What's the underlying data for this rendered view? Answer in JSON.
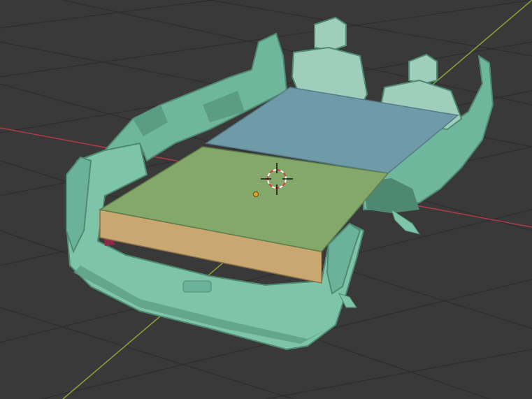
{
  "app": "3D viewport",
  "viewport": {
    "background": "#393939",
    "grid_color": "#2b2b2b",
    "x_axis_color": "#b03a48",
    "y_axis_color": "#8aa43a"
  },
  "scene": {
    "vehicle_mesh": {
      "color": "#7ec4a8",
      "shadow": "#4f8a72"
    },
    "floor_plane": {
      "color": "#6f9aa8"
    },
    "platform_box": {
      "top_color": "#84a86a",
      "side_color": "#c9a770",
      "underside_color": "#8a2a44"
    },
    "origin_point_color": "#f0a020",
    "cursor_3d": {
      "ring_colors": [
        "#ffffff",
        "#d04040"
      ]
    }
  }
}
